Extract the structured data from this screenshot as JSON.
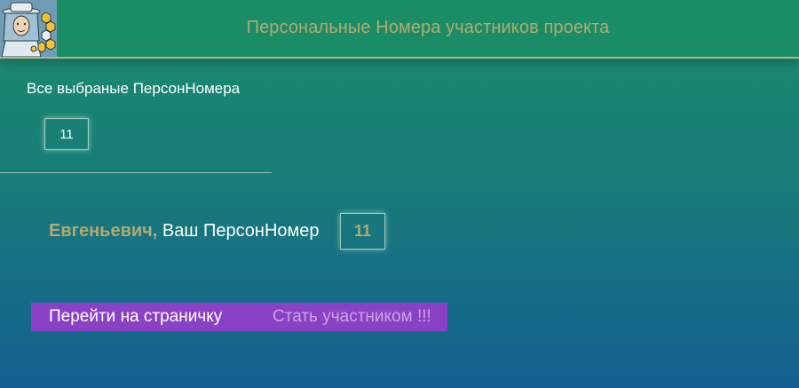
{
  "header": {
    "title": "Персональные Номера участников проекта",
    "avatar_icon": "beekeeper-avatar-icon"
  },
  "selected": {
    "label": "Все выбраные ПерсонНомера",
    "numbers": [
      "11"
    ]
  },
  "user": {
    "name": "Евгеньевич,",
    "text": " Ваш ПерсонНомер",
    "number": "11"
  },
  "buttons": {
    "goto_label": "Перейти на страничку",
    "join_label": "Стать участником !!!"
  },
  "colors": {
    "header_bg": "#1a8d66",
    "accent_gold": "#b2aa70",
    "button_purple": "#8b41c6"
  }
}
